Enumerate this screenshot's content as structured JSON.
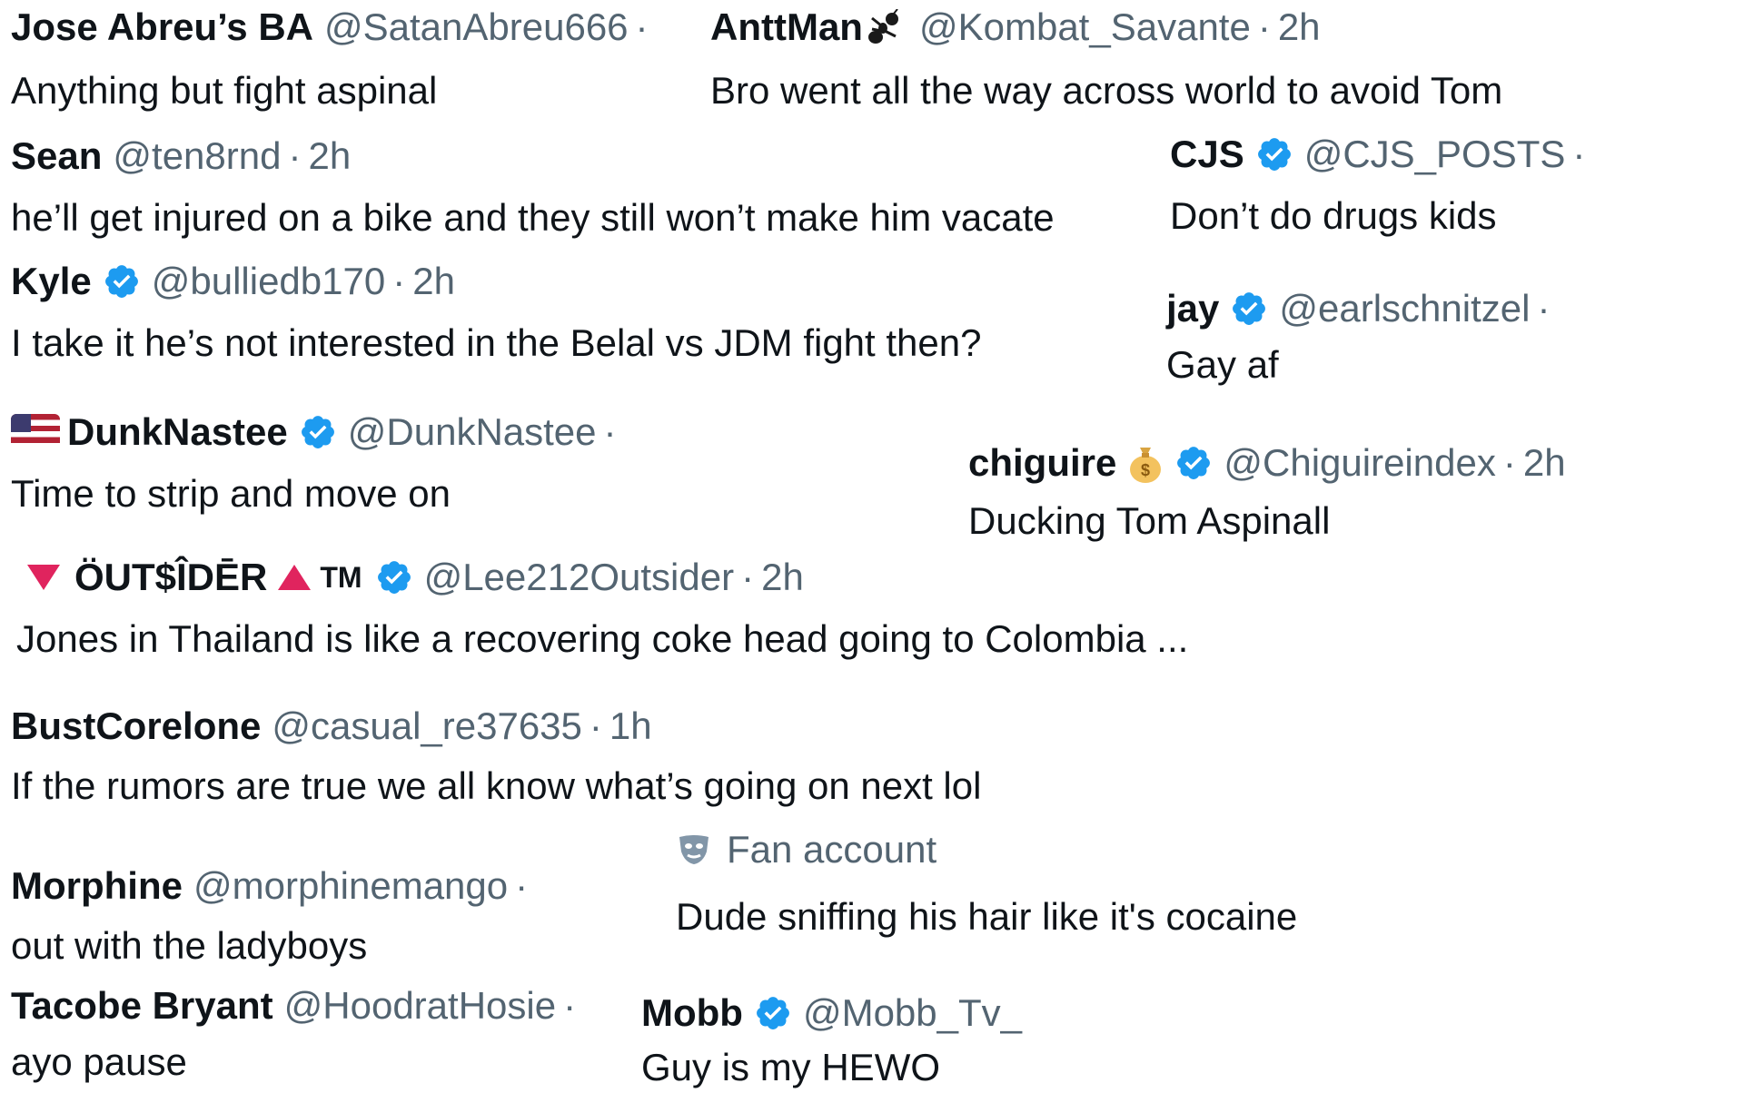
{
  "replies": [
    {
      "name": "Jose Abreu’s BA",
      "handle": "@SatanAbreu666",
      "dot": "·",
      "text": "Anything but fight aspinal"
    },
    {
      "name": "AnttMan",
      "handle": "@Kombat_Savante",
      "dot": "·",
      "time": "2h",
      "text": "Bro went all the way across world to avoid Tom"
    },
    {
      "name": "Sean",
      "handle": "@ten8rnd",
      "dot": "·",
      "time": "2h",
      "text": "he’ll get injured on a bike and they still won’t make him vacate"
    },
    {
      "name": "CJS",
      "handle": "@CJS_POSTS",
      "dot": "·",
      "text": "Don’t do drugs kids"
    },
    {
      "name": "Kyle",
      "handle": "@bulliedb170",
      "dot": "·",
      "time": "2h",
      "text": "I take it he’s not interested in the Belal vs JDM fight then?"
    },
    {
      "name": "jay",
      "handle": "@earlschnitzel",
      "dot": "·",
      "text": "Gay af"
    },
    {
      "name": "DunkNastee",
      "handle": "@DunkNastee",
      "dot": "·",
      "text": "Time to strip and move on"
    },
    {
      "name": "chiguire",
      "handle": "@Chiguireindex",
      "dot": "·",
      "time": "2h",
      "text": "Ducking Tom Aspinall"
    },
    {
      "name": "ÖUT$ÎDĒR",
      "suffix": "TM",
      "handle": "@Lee212Outsider",
      "dot": "·",
      "time": "2h",
      "text": "Jones in Thailand is like a recovering coke head going to Colombia ..."
    },
    {
      "name": "BustCorelone",
      "handle": "@casual_re37635",
      "dot": "·",
      "time": "1h",
      "text": "If the rumors are true we all know what’s going on next lol"
    },
    {
      "label": "Fan account",
      "text": "Dude sniffing his hair like it's cocaine"
    },
    {
      "name": "Morphine",
      "handle": "@morphinemango",
      "dot": "·",
      "text": "out with the ladyboys"
    },
    {
      "name": "Tacobe Bryant",
      "handle": "@HoodratHosie",
      "dot": "·",
      "text": "ayo pause"
    },
    {
      "name": "Mobb",
      "handle": "@Mobb_Tv_",
      "text": "Guy is my HEWO"
    }
  ],
  "colors": {
    "verified": "#1d9bf0",
    "handle": "#536471",
    "text": "#0f1419",
    "triangle": "#e0245e"
  },
  "icons": {
    "verified": "verified-badge-icon",
    "ant": "ant-icon",
    "flag": "us-flag-icon",
    "moneybag": "money-bag-icon",
    "mask": "fan-account-mask-icon"
  }
}
